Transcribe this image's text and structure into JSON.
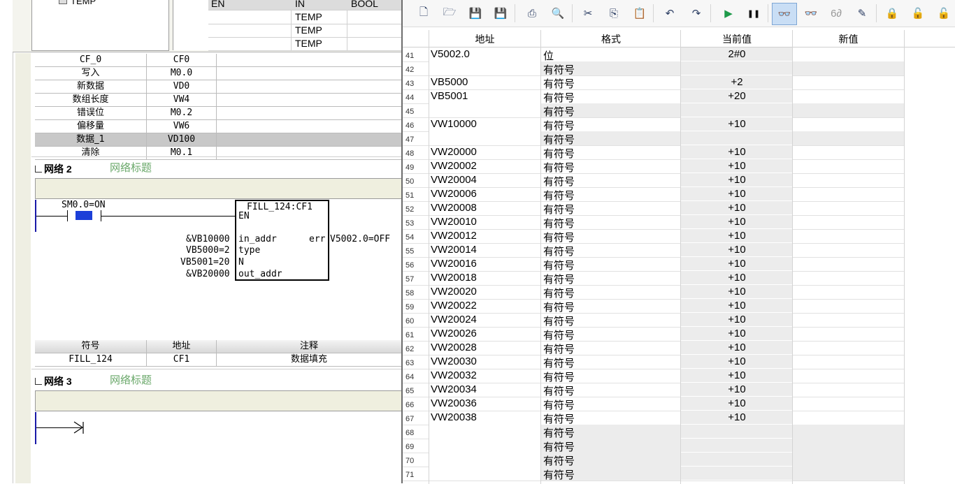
{
  "top_tree": {
    "item": "TEMP"
  },
  "var_table": {
    "rows": [
      {
        "name": "EN",
        "type": "IN",
        "dtype": "BOOL"
      },
      {
        "name": "",
        "type": "TEMP",
        "dtype": ""
      },
      {
        "name": "",
        "type": "TEMP",
        "dtype": ""
      },
      {
        "name": "",
        "type": "TEMP",
        "dtype": ""
      }
    ]
  },
  "symbol_table_1": [
    {
      "sym": "CF_0",
      "addr": "CF0",
      "note": ""
    },
    {
      "sym": "写入",
      "addr": "M0.0",
      "note": ""
    },
    {
      "sym": "新数据",
      "addr": "VD0",
      "note": ""
    },
    {
      "sym": "数组长度",
      "addr": "VW4",
      "note": ""
    },
    {
      "sym": "错误位",
      "addr": "M0.2",
      "note": ""
    },
    {
      "sym": "偏移量",
      "addr": "VW6",
      "note": ""
    },
    {
      "sym": "数据_1",
      "addr": "VD100",
      "note": ""
    },
    {
      "sym": "清除",
      "addr": "M0.1",
      "note": ""
    }
  ],
  "network2": {
    "label": "网络 2",
    "title": "网络标题",
    "contact": "SM0.0=ON",
    "block_name": "FILL_124:CF1",
    "pin_en": "EN",
    "pins_left": [
      {
        "value": "&VB10000",
        "pin": "in_addr"
      },
      {
        "value": "VB5000=2",
        "pin": "type"
      },
      {
        "value": "VB5001=20",
        "pin": "N"
      },
      {
        "value": "&VB20000",
        "pin": "out_addr"
      }
    ],
    "pin_err": "err",
    "err_value": "V5002.0=OFF"
  },
  "symbol_table_2": {
    "header": {
      "sym": "符号",
      "addr": "地址",
      "note": "注释"
    },
    "rows": [
      {
        "sym": "FILL_124",
        "addr": "CF1",
        "note": "数据填充"
      }
    ]
  },
  "network3": {
    "label": "网络 3",
    "title": "网络标题"
  },
  "toolbar": {
    "icons": [
      "new-file-icon",
      "open-folder-icon",
      "save-icon",
      "save-all-icon",
      "print-icon",
      "print-preview-icon",
      "cut-icon",
      "copy-icon",
      "paste-icon",
      "undo-icon",
      "redo-icon",
      "run-icon",
      "pause-icon",
      "chart-status-icon",
      "single-read-icon",
      "watch-icon",
      "trend-pen-icon",
      "lock-icon",
      "unlock-icon",
      "unlock-all-icon"
    ]
  },
  "status_chart": {
    "headers": {
      "addr": "地址",
      "format": "格式",
      "current": "当前值",
      "new": "新值"
    },
    "rows": [
      {
        "n": "41",
        "addr": "V5002.0",
        "format": "位",
        "current": "2#0"
      },
      {
        "n": "42",
        "addr": "",
        "format": "有符号",
        "current": ""
      },
      {
        "n": "43",
        "addr": "VB5000",
        "format": "有符号",
        "current": "+2"
      },
      {
        "n": "44",
        "addr": "VB5001",
        "format": "有符号",
        "current": "+20"
      },
      {
        "n": "45",
        "addr": "",
        "format": "有符号",
        "current": ""
      },
      {
        "n": "46",
        "addr": "VW10000",
        "format": "有符号",
        "current": "+10"
      },
      {
        "n": "47",
        "addr": "",
        "format": "有符号",
        "current": ""
      },
      {
        "n": "48",
        "addr": "VW20000",
        "format": "有符号",
        "current": "+10"
      },
      {
        "n": "49",
        "addr": "VW20002",
        "format": "有符号",
        "current": "+10"
      },
      {
        "n": "50",
        "addr": "VW20004",
        "format": "有符号",
        "current": "+10"
      },
      {
        "n": "51",
        "addr": "VW20006",
        "format": "有符号",
        "current": "+10"
      },
      {
        "n": "52",
        "addr": "VW20008",
        "format": "有符号",
        "current": "+10"
      },
      {
        "n": "53",
        "addr": "VW20010",
        "format": "有符号",
        "current": "+10"
      },
      {
        "n": "54",
        "addr": "VW20012",
        "format": "有符号",
        "current": "+10"
      },
      {
        "n": "55",
        "addr": "VW20014",
        "format": "有符号",
        "current": "+10"
      },
      {
        "n": "56",
        "addr": "VW20016",
        "format": "有符号",
        "current": "+10"
      },
      {
        "n": "57",
        "addr": "VW20018",
        "format": "有符号",
        "current": "+10"
      },
      {
        "n": "58",
        "addr": "VW20020",
        "format": "有符号",
        "current": "+10"
      },
      {
        "n": "59",
        "addr": "VW20022",
        "format": "有符号",
        "current": "+10"
      },
      {
        "n": "60",
        "addr": "VW20024",
        "format": "有符号",
        "current": "+10"
      },
      {
        "n": "61",
        "addr": "VW20026",
        "format": "有符号",
        "current": "+10"
      },
      {
        "n": "62",
        "addr": "VW20028",
        "format": "有符号",
        "current": "+10"
      },
      {
        "n": "63",
        "addr": "VW20030",
        "format": "有符号",
        "current": "+10"
      },
      {
        "n": "64",
        "addr": "VW20032",
        "format": "有符号",
        "current": "+10"
      },
      {
        "n": "65",
        "addr": "VW20034",
        "format": "有符号",
        "current": "+10"
      },
      {
        "n": "66",
        "addr": "VW20036",
        "format": "有符号",
        "current": "+10"
      },
      {
        "n": "67",
        "addr": "VW20038",
        "format": "有符号",
        "current": "+10"
      },
      {
        "n": "68",
        "addr": "",
        "format": "有符号",
        "current": ""
      },
      {
        "n": "69",
        "addr": "",
        "format": "有符号",
        "current": ""
      },
      {
        "n": "70",
        "addr": "",
        "format": "有符号",
        "current": ""
      },
      {
        "n": "71",
        "addr": "",
        "format": "有符号",
        "current": ""
      }
    ]
  }
}
